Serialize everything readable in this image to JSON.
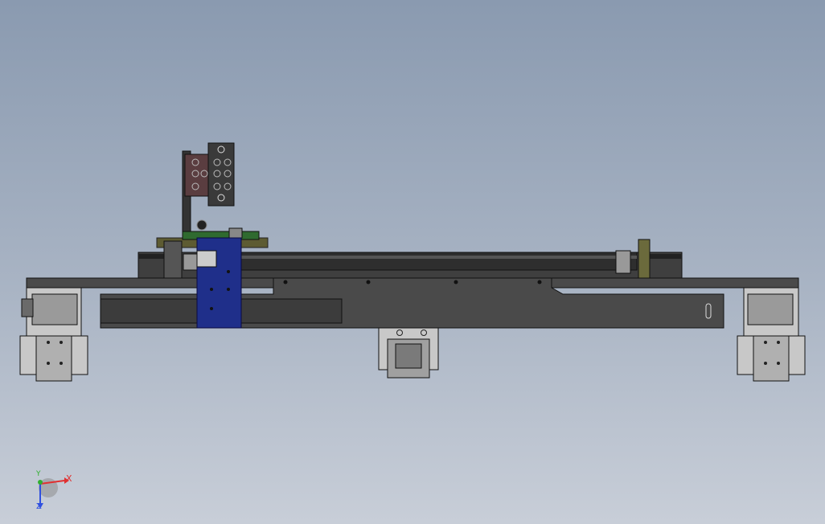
{
  "viewport": {
    "background_top": "#8a9ab0",
    "background_bottom": "#c8ced8"
  },
  "colors": {
    "frame_gray": "#4a4a4a",
    "frame_dark": "#3c3c3c",
    "plate_light": "#c8c8c8",
    "carriage_blue": "#1f2f8a",
    "pcb_green": "#2f6a2f",
    "bracket_olive": "#6b6a3c"
  },
  "triad": {
    "x_label": "X",
    "y_label": "Y",
    "z_label": "Z",
    "x_color": "#e03030",
    "y_color": "#30b030",
    "z_color": "#3050e0"
  }
}
